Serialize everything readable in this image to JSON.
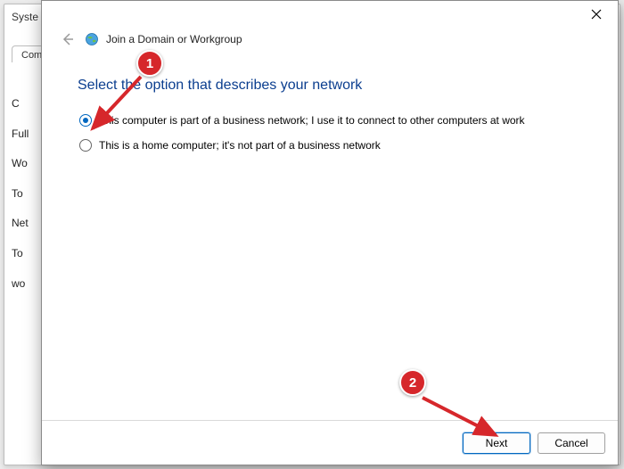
{
  "background": {
    "title_fragment": "Syste",
    "tab_label": "Comp",
    "side_labels": [
      "C",
      "Full",
      "Wo",
      "To",
      "Net",
      "To",
      "wo"
    ]
  },
  "wizard": {
    "title": "Join a Domain or Workgroup",
    "heading": "Select the option that describes your network",
    "options": [
      {
        "label": "This computer is part of a business network; I use it to connect to other computers at work",
        "selected": true
      },
      {
        "label": "This is a home computer; it's not part of a business network",
        "selected": false
      }
    ],
    "buttons": {
      "next": "Next",
      "cancel": "Cancel"
    }
  },
  "annotations": {
    "badge1": "1",
    "badge2": "2"
  }
}
